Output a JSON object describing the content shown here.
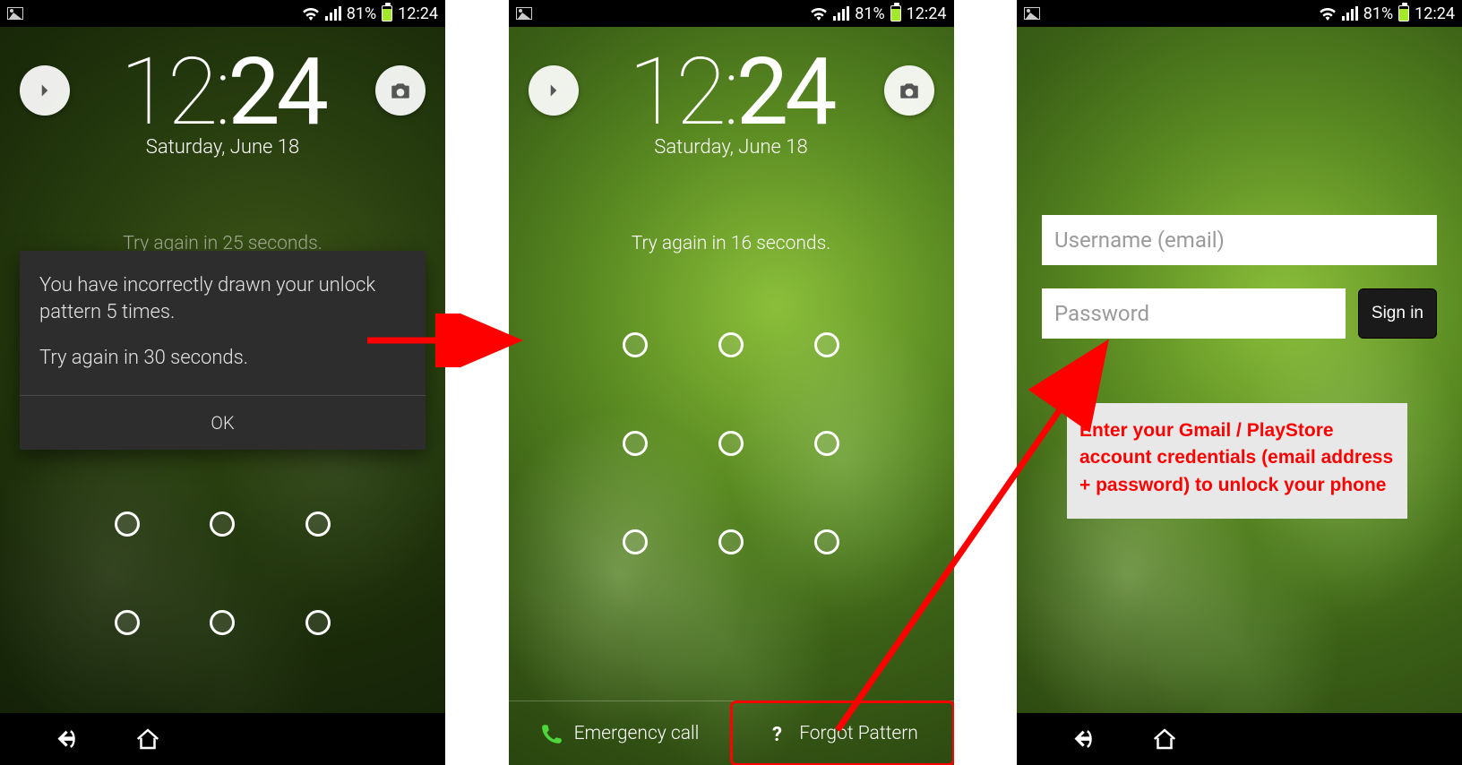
{
  "statusbar": {
    "battery_pct": "81%",
    "time": "12:24"
  },
  "lock": {
    "clock_h": "12",
    "clock_m": "24",
    "date": "Saturday, June 18"
  },
  "phone1": {
    "tryagain_faint": "Try again in 25 seconds.",
    "dialog_line1": "You have incorrectly drawn your unlock pattern 5 times.",
    "dialog_line2": "Try again in 30 seconds.",
    "dialog_ok": "OK"
  },
  "phone2": {
    "tryagain": "Try again in 16 seconds.",
    "emergency": "Emergency call",
    "forgot": "Forgot Pattern"
  },
  "phone3": {
    "username_ph": "Username (email)",
    "password_ph": "Password",
    "signin": "Sign in",
    "callout": "Enter your Gmail / PlayStore account credentials (email address + password) to unlock your phone"
  }
}
